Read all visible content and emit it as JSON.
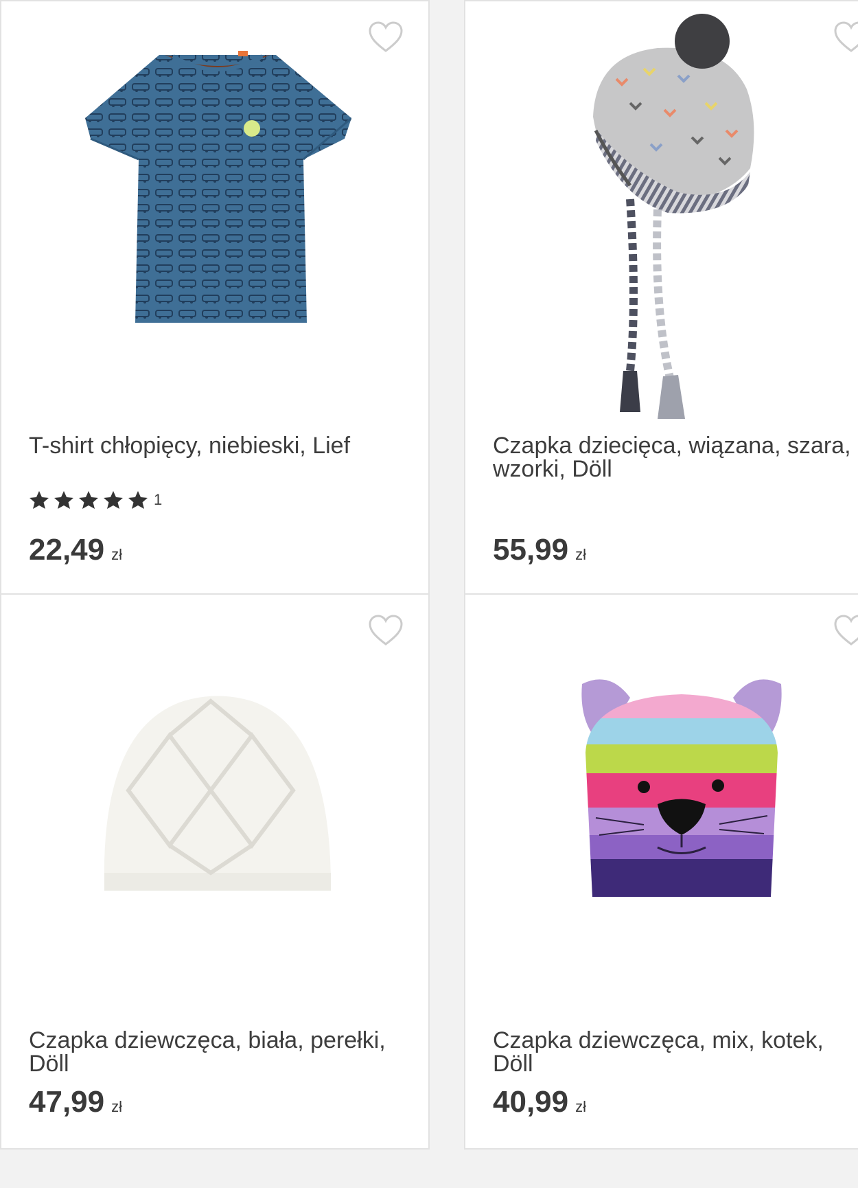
{
  "colors": {
    "card_border": "#e2e2e2",
    "heart": "#cccccc",
    "star": "#333333",
    "text": "#3d3d3d"
  },
  "products": [
    {
      "title": "T-shirt chłopięcy, niebieski, Lief",
      "rating": {
        "stars": 5,
        "count": "1"
      },
      "price": "22,49",
      "currency": "zł",
      "image": "blue-tshirt-cars-pattern"
    },
    {
      "title": "Czapka dziecięca, wiązana, szara, wzorki, Döll",
      "price": "55,99",
      "currency": "zł",
      "image": "grey-knit-hat-pompom"
    },
    {
      "title": "Czapka dziewczęca, biała, perełki, Döll",
      "price": "47,99",
      "currency": "zł",
      "image": "white-knit-beanie"
    },
    {
      "title": "Czapka dziewczęca, mix, kotek, Döll",
      "price": "40,99",
      "currency": "zł",
      "image": "striped-cat-hat"
    }
  ]
}
